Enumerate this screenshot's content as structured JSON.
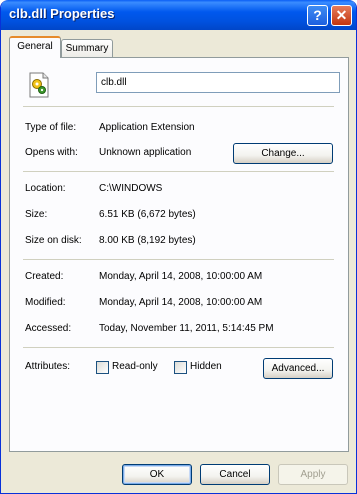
{
  "window": {
    "title": "clb.dll Properties"
  },
  "tabs": [
    {
      "label": "General",
      "selected": true
    },
    {
      "label": "Summary",
      "selected": false
    }
  ],
  "file": {
    "name": "clb.dll",
    "icon": "dll-file-icon"
  },
  "info": {
    "type_label": "Type of file:",
    "type_value": "Application Extension",
    "opens_label": "Opens with:",
    "opens_value": "Unknown application",
    "change_button": "Change...",
    "location_label": "Location:",
    "location_value": "C:\\WINDOWS",
    "size_label": "Size:",
    "size_value": "6.51 KB (6,672 bytes)",
    "size_disk_label": "Size on disk:",
    "size_disk_value": "8.00 KB (8,192 bytes)",
    "created_label": "Created:",
    "created_value": "Monday, April 14, 2008, 10:00:00 AM",
    "modified_label": "Modified:",
    "modified_value": "Monday, April 14, 2008, 10:00:00 AM",
    "accessed_label": "Accessed:",
    "accessed_value": "Today, November 11, 2011, 5:14:45 PM"
  },
  "attributes": {
    "label": "Attributes:",
    "readonly_label": "Read-only",
    "readonly_checked": false,
    "hidden_label": "Hidden",
    "hidden_checked": false,
    "advanced_button": "Advanced..."
  },
  "footer": {
    "ok": "OK",
    "cancel": "Cancel",
    "apply": "Apply"
  },
  "colors": {
    "titlebar": "#0058ee",
    "dialog_bg": "#ece9d8",
    "panel_bg": "#fcfcfe",
    "tab_accent": "#e68b2c"
  }
}
